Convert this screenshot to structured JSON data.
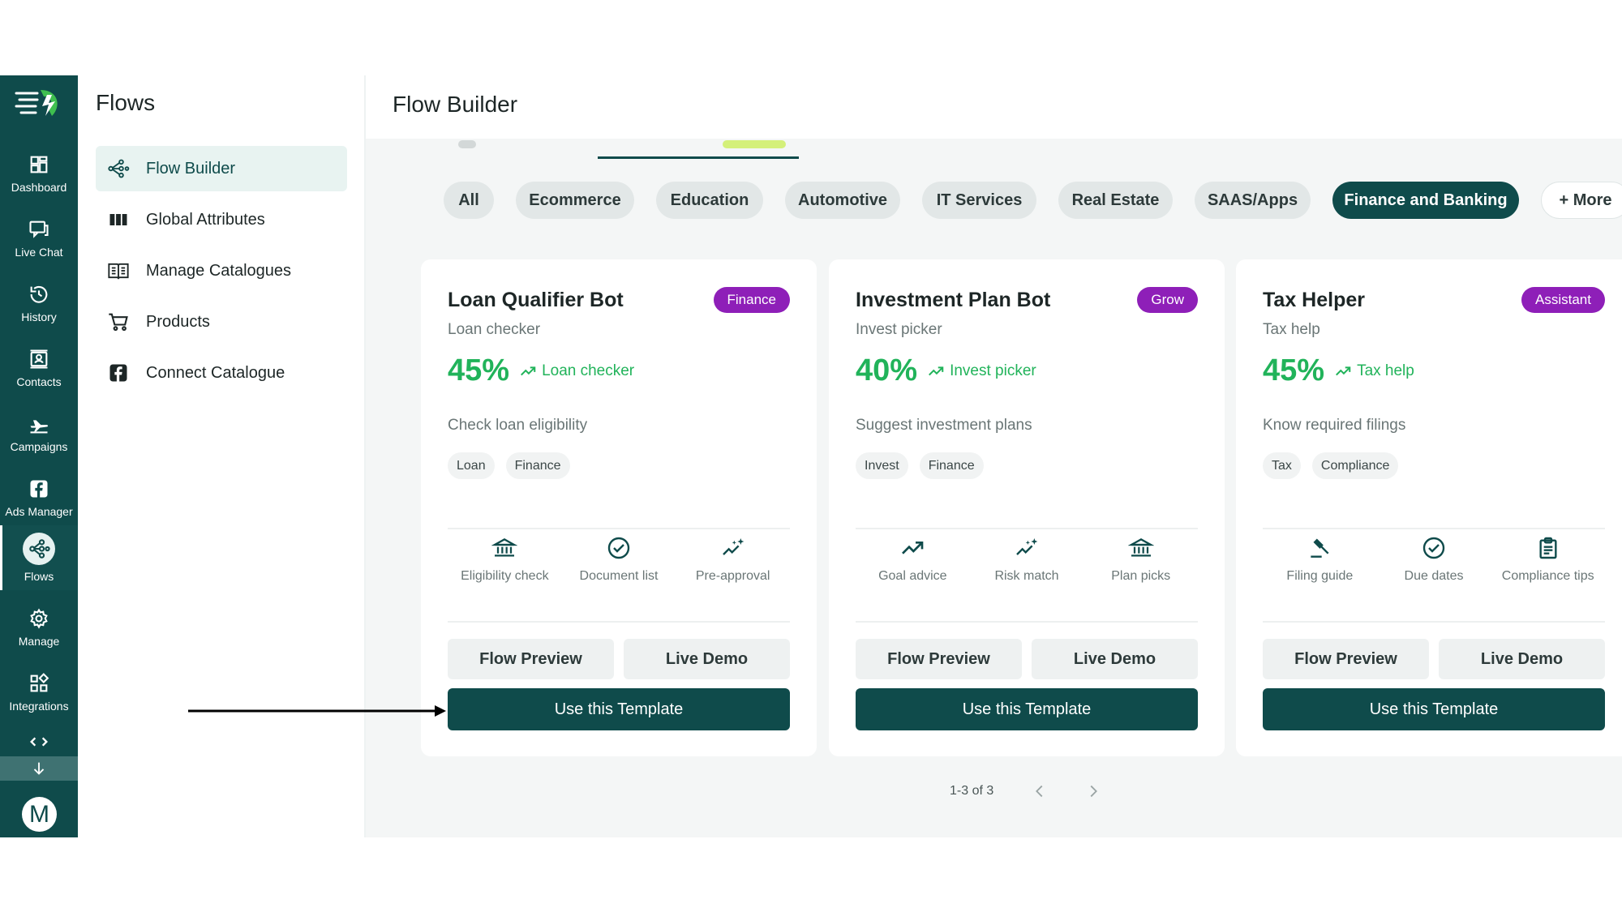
{
  "rail": {
    "items": [
      {
        "label": "Dashboard",
        "icon": "dashboard-icon"
      },
      {
        "label": "Live Chat",
        "icon": "chat-icon"
      },
      {
        "label": "History",
        "icon": "history-icon"
      },
      {
        "label": "Contacts",
        "icon": "contacts-icon"
      },
      {
        "label": "Campaigns",
        "icon": "plane-icon"
      },
      {
        "label": "Ads Manager",
        "icon": "facebook-icon"
      },
      {
        "label": "Flows",
        "icon": "flows-icon"
      },
      {
        "label": "Manage",
        "icon": "gear-icon"
      },
      {
        "label": "Integrations",
        "icon": "integrations-icon"
      }
    ],
    "avatar": "M"
  },
  "sidebar": {
    "title": "Flows",
    "items": [
      {
        "label": "Flow Builder",
        "icon": "flow-icon"
      },
      {
        "label": "Global Attributes",
        "icon": "columns-icon"
      },
      {
        "label": "Manage Catalogues",
        "icon": "book-icon"
      },
      {
        "label": "Products",
        "icon": "cart-icon"
      },
      {
        "label": "Connect Catalogue",
        "icon": "facebook-icon"
      }
    ]
  },
  "main": {
    "title": "Flow Builder",
    "chips": [
      "All",
      "Ecommerce",
      "Education",
      "Automotive",
      "IT Services",
      "Real Estate",
      "SAAS/Apps",
      "Finance and Banking",
      "+ More"
    ],
    "active_chip": "Finance and Banking",
    "cards": [
      {
        "title": "Loan Qualifier Bot",
        "badge": "Finance",
        "subtitle": "Loan checker",
        "percent": "45%",
        "trend": "Loan checker",
        "description": "Check loan eligibility",
        "tags": [
          "Loan",
          "Finance"
        ],
        "features": [
          {
            "label": "Eligibility check",
            "icon": "bank-icon"
          },
          {
            "label": "Document list",
            "icon": "check-circle-icon"
          },
          {
            "label": "Pre-approval",
            "icon": "sparkle-trend-icon"
          }
        ],
        "preview": "Flow Preview",
        "demo": "Live Demo",
        "cta": "Use this Template"
      },
      {
        "title": "Investment Plan Bot",
        "badge": "Grow",
        "subtitle": "Invest picker",
        "percent": "40%",
        "trend": "Invest picker",
        "description": "Suggest investment plans",
        "tags": [
          "Invest",
          "Finance"
        ],
        "features": [
          {
            "label": "Goal advice",
            "icon": "trend-up-icon"
          },
          {
            "label": "Risk match",
            "icon": "sparkle-trend-icon"
          },
          {
            "label": "Plan picks",
            "icon": "bank-icon"
          }
        ],
        "preview": "Flow Preview",
        "demo": "Live Demo",
        "cta": "Use this Template"
      },
      {
        "title": "Tax Helper",
        "badge": "Assistant",
        "subtitle": "Tax help",
        "percent": "45%",
        "trend": "Tax help",
        "description": "Know required filings",
        "tags": [
          "Tax",
          "Compliance"
        ],
        "features": [
          {
            "label": "Filing guide",
            "icon": "gavel-icon"
          },
          {
            "label": "Due dates",
            "icon": "check-circle-icon"
          },
          {
            "label": "Compliance tips",
            "icon": "clipboard-icon"
          }
        ],
        "preview": "Flow Preview",
        "demo": "Live Demo",
        "cta": "Use this Template"
      }
    ],
    "pagination": {
      "text": "1-3 of 3"
    }
  },
  "colors": {
    "brand": "#0f4b4b",
    "accent_green": "#21b35a",
    "badge_purple": "#8e1fb8",
    "chip_bg": "#e2e7e7"
  }
}
